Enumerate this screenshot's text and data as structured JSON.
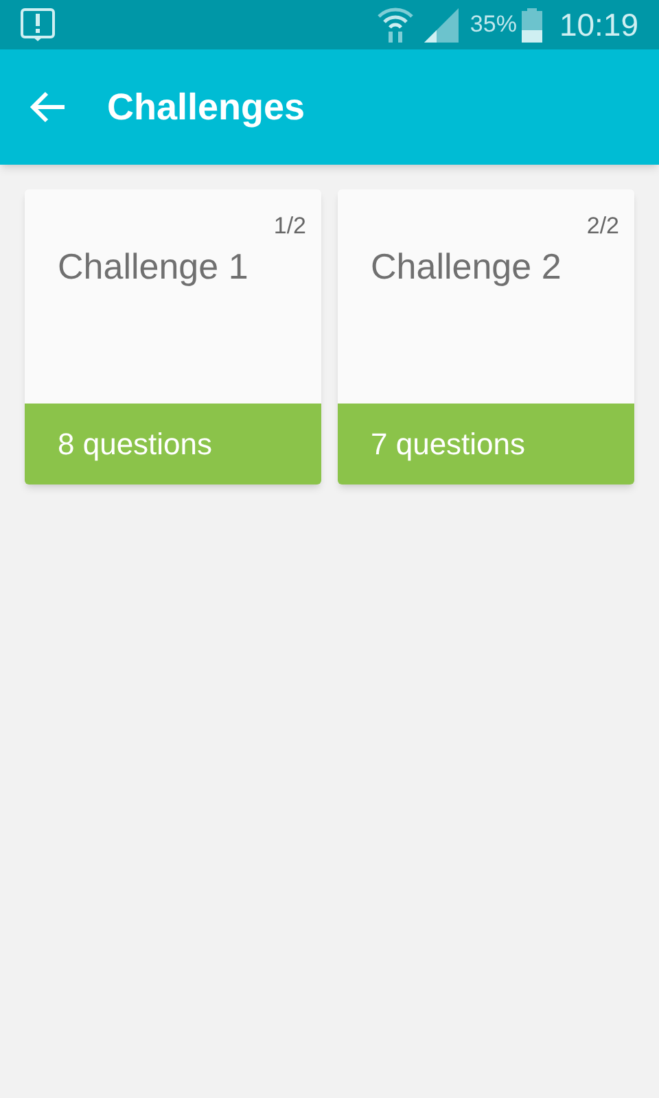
{
  "status_bar": {
    "battery": "35%",
    "time": "10:19"
  },
  "app_bar": {
    "title": "Challenges"
  },
  "challenges": [
    {
      "counter": "1/2",
      "title": "Challenge 1",
      "questions": "8 questions"
    },
    {
      "counter": "2/2",
      "title": "Challenge 2",
      "questions": "7 questions"
    }
  ]
}
